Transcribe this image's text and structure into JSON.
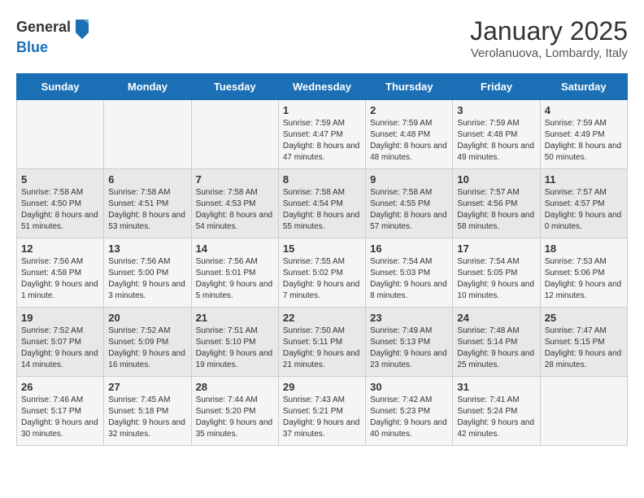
{
  "header": {
    "logo_line1": "General",
    "logo_line2": "Blue",
    "title": "January 2025",
    "subtitle": "Verolanuova, Lombardy, Italy"
  },
  "weekdays": [
    "Sunday",
    "Monday",
    "Tuesday",
    "Wednesday",
    "Thursday",
    "Friday",
    "Saturday"
  ],
  "weeks": [
    [
      {
        "day": "",
        "info": ""
      },
      {
        "day": "",
        "info": ""
      },
      {
        "day": "",
        "info": ""
      },
      {
        "day": "1",
        "info": "Sunrise: 7:59 AM\nSunset: 4:47 PM\nDaylight: 8 hours and 47 minutes."
      },
      {
        "day": "2",
        "info": "Sunrise: 7:59 AM\nSunset: 4:48 PM\nDaylight: 8 hours and 48 minutes."
      },
      {
        "day": "3",
        "info": "Sunrise: 7:59 AM\nSunset: 4:48 PM\nDaylight: 8 hours and 49 minutes."
      },
      {
        "day": "4",
        "info": "Sunrise: 7:59 AM\nSunset: 4:49 PM\nDaylight: 8 hours and 50 minutes."
      }
    ],
    [
      {
        "day": "5",
        "info": "Sunrise: 7:58 AM\nSunset: 4:50 PM\nDaylight: 8 hours and 51 minutes."
      },
      {
        "day": "6",
        "info": "Sunrise: 7:58 AM\nSunset: 4:51 PM\nDaylight: 8 hours and 53 minutes."
      },
      {
        "day": "7",
        "info": "Sunrise: 7:58 AM\nSunset: 4:53 PM\nDaylight: 8 hours and 54 minutes."
      },
      {
        "day": "8",
        "info": "Sunrise: 7:58 AM\nSunset: 4:54 PM\nDaylight: 8 hours and 55 minutes."
      },
      {
        "day": "9",
        "info": "Sunrise: 7:58 AM\nSunset: 4:55 PM\nDaylight: 8 hours and 57 minutes."
      },
      {
        "day": "10",
        "info": "Sunrise: 7:57 AM\nSunset: 4:56 PM\nDaylight: 8 hours and 58 minutes."
      },
      {
        "day": "11",
        "info": "Sunrise: 7:57 AM\nSunset: 4:57 PM\nDaylight: 9 hours and 0 minutes."
      }
    ],
    [
      {
        "day": "12",
        "info": "Sunrise: 7:56 AM\nSunset: 4:58 PM\nDaylight: 9 hours and 1 minute."
      },
      {
        "day": "13",
        "info": "Sunrise: 7:56 AM\nSunset: 5:00 PM\nDaylight: 9 hours and 3 minutes."
      },
      {
        "day": "14",
        "info": "Sunrise: 7:56 AM\nSunset: 5:01 PM\nDaylight: 9 hours and 5 minutes."
      },
      {
        "day": "15",
        "info": "Sunrise: 7:55 AM\nSunset: 5:02 PM\nDaylight: 9 hours and 7 minutes."
      },
      {
        "day": "16",
        "info": "Sunrise: 7:54 AM\nSunset: 5:03 PM\nDaylight: 9 hours and 8 minutes."
      },
      {
        "day": "17",
        "info": "Sunrise: 7:54 AM\nSunset: 5:05 PM\nDaylight: 9 hours and 10 minutes."
      },
      {
        "day": "18",
        "info": "Sunrise: 7:53 AM\nSunset: 5:06 PM\nDaylight: 9 hours and 12 minutes."
      }
    ],
    [
      {
        "day": "19",
        "info": "Sunrise: 7:52 AM\nSunset: 5:07 PM\nDaylight: 9 hours and 14 minutes."
      },
      {
        "day": "20",
        "info": "Sunrise: 7:52 AM\nSunset: 5:09 PM\nDaylight: 9 hours and 16 minutes."
      },
      {
        "day": "21",
        "info": "Sunrise: 7:51 AM\nSunset: 5:10 PM\nDaylight: 9 hours and 19 minutes."
      },
      {
        "day": "22",
        "info": "Sunrise: 7:50 AM\nSunset: 5:11 PM\nDaylight: 9 hours and 21 minutes."
      },
      {
        "day": "23",
        "info": "Sunrise: 7:49 AM\nSunset: 5:13 PM\nDaylight: 9 hours and 23 minutes."
      },
      {
        "day": "24",
        "info": "Sunrise: 7:48 AM\nSunset: 5:14 PM\nDaylight: 9 hours and 25 minutes."
      },
      {
        "day": "25",
        "info": "Sunrise: 7:47 AM\nSunset: 5:15 PM\nDaylight: 9 hours and 28 minutes."
      }
    ],
    [
      {
        "day": "26",
        "info": "Sunrise: 7:46 AM\nSunset: 5:17 PM\nDaylight: 9 hours and 30 minutes."
      },
      {
        "day": "27",
        "info": "Sunrise: 7:45 AM\nSunset: 5:18 PM\nDaylight: 9 hours and 32 minutes."
      },
      {
        "day": "28",
        "info": "Sunrise: 7:44 AM\nSunset: 5:20 PM\nDaylight: 9 hours and 35 minutes."
      },
      {
        "day": "29",
        "info": "Sunrise: 7:43 AM\nSunset: 5:21 PM\nDaylight: 9 hours and 37 minutes."
      },
      {
        "day": "30",
        "info": "Sunrise: 7:42 AM\nSunset: 5:23 PM\nDaylight: 9 hours and 40 minutes."
      },
      {
        "day": "31",
        "info": "Sunrise: 7:41 AM\nSunset: 5:24 PM\nDaylight: 9 hours and 42 minutes."
      },
      {
        "day": "",
        "info": ""
      }
    ]
  ]
}
